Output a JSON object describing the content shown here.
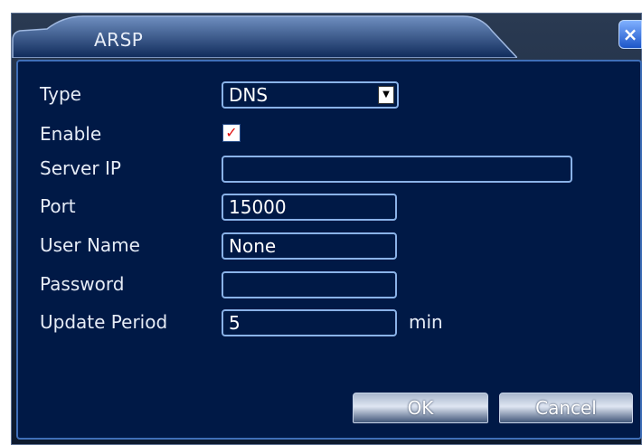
{
  "dialog": {
    "title": "ARSP",
    "close_label": "×"
  },
  "form": {
    "type_label": "Type",
    "type_value": "DNS",
    "enable_label": "Enable",
    "enable_checked": true,
    "enable_mark": "✓",
    "server_ip_label": "Server IP",
    "server_ip_value": "",
    "port_label": "Port",
    "port_value": "15000",
    "user_name_label": "User Name",
    "user_name_value": "None",
    "password_label": "Password",
    "password_value": "",
    "update_period_label": "Update Period",
    "update_period_value": "5",
    "update_period_unit": "min"
  },
  "buttons": {
    "ok_label": "OK",
    "cancel_label": "Cancel"
  },
  "colors": {
    "panel_bg": "#001946",
    "field_border": "#8ab2e8",
    "check_mark": "#e01010",
    "close_button": "#1c55c8"
  },
  "icons": {
    "dropdown": "triangle-down-icon",
    "close": "close-icon",
    "check": "checkmark-icon"
  }
}
